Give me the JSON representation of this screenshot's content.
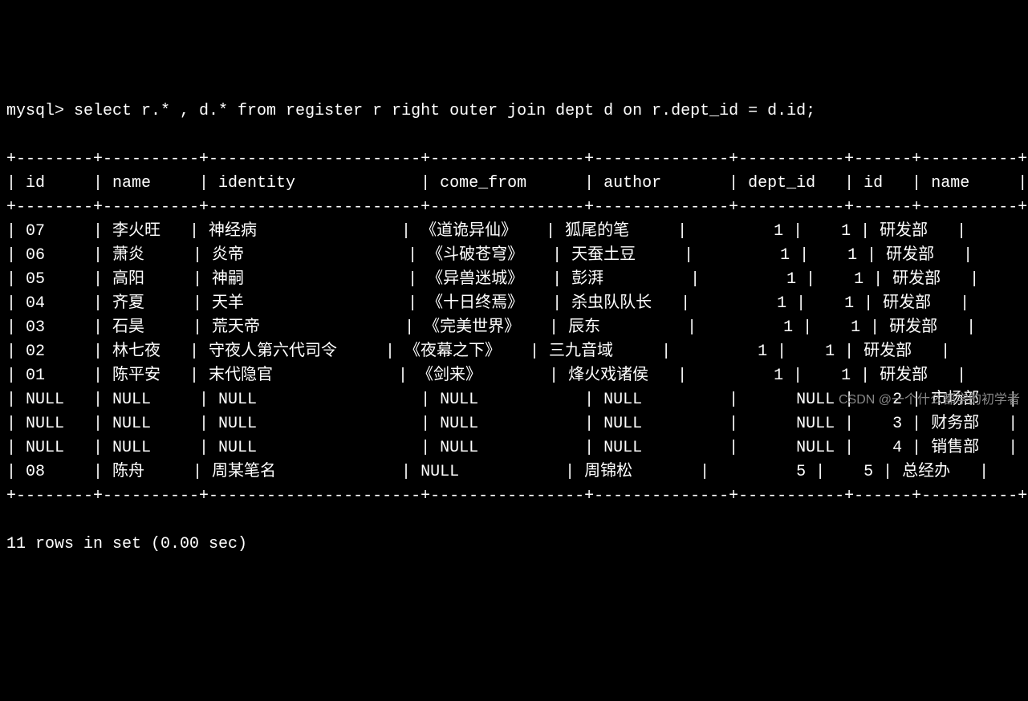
{
  "prompt_prefix": "mysql> ",
  "query": "select r.* , d.* from register r right outer join dept d on r.dept_id = d.id;",
  "columns": [
    "id",
    "name",
    "identity",
    "come_from",
    "author",
    "dept_id",
    "id",
    "name"
  ],
  "rows": [
    {
      "id": "07",
      "name": "李火旺",
      "identity": "神经病",
      "come_from": "《道诡异仙》",
      "author": "狐尾的笔",
      "dept_id": "1",
      "id2": "1",
      "name2": "研发部"
    },
    {
      "id": "06",
      "name": "萧炎",
      "identity": "炎帝",
      "come_from": "《斗破苍穹》",
      "author": "天蚕土豆",
      "dept_id": "1",
      "id2": "1",
      "name2": "研发部"
    },
    {
      "id": "05",
      "name": "高阳",
      "identity": "神嗣",
      "come_from": "《异兽迷城》",
      "author": "彭湃",
      "dept_id": "1",
      "id2": "1",
      "name2": "研发部"
    },
    {
      "id": "04",
      "name": "齐夏",
      "identity": "天羊",
      "come_from": "《十日终焉》",
      "author": "杀虫队队长",
      "dept_id": "1",
      "id2": "1",
      "name2": "研发部"
    },
    {
      "id": "03",
      "name": "石昊",
      "identity": "荒天帝",
      "come_from": "《完美世界》",
      "author": "辰东",
      "dept_id": "1",
      "id2": "1",
      "name2": "研发部"
    },
    {
      "id": "02",
      "name": "林七夜",
      "identity": "守夜人第六代司令",
      "come_from": "《夜幕之下》",
      "author": "三九音域",
      "dept_id": "1",
      "id2": "1",
      "name2": "研发部"
    },
    {
      "id": "01",
      "name": "陈平安",
      "identity": "末代隐官",
      "come_from": "《剑来》",
      "author": "烽火戏诸侯",
      "dept_id": "1",
      "id2": "1",
      "name2": "研发部"
    },
    {
      "id": "NULL",
      "name": "NULL",
      "identity": "NULL",
      "come_from": "NULL",
      "author": "NULL",
      "dept_id": "NULL",
      "id2": "2",
      "name2": "市场部"
    },
    {
      "id": "NULL",
      "name": "NULL",
      "identity": "NULL",
      "come_from": "NULL",
      "author": "NULL",
      "dept_id": "NULL",
      "id2": "3",
      "name2": "财务部"
    },
    {
      "id": "NULL",
      "name": "NULL",
      "identity": "NULL",
      "come_from": "NULL",
      "author": "NULL",
      "dept_id": "NULL",
      "id2": "4",
      "name2": "销售部"
    },
    {
      "id": "08",
      "name": "陈舟",
      "identity": "周某笔名",
      "come_from": "NULL",
      "author": "周锦松",
      "dept_id": "5",
      "id2": "5",
      "name2": "总经办"
    }
  ],
  "status_line": "11 rows in set (0.00 sec)",
  "watermark": "CSDN @一个什么都学的初学者",
  "widths": {
    "id": 6,
    "name": 8,
    "identity": 20,
    "come_from": 14,
    "author": 12,
    "dept_id": 9,
    "id2": 4,
    "name2": 8
  }
}
